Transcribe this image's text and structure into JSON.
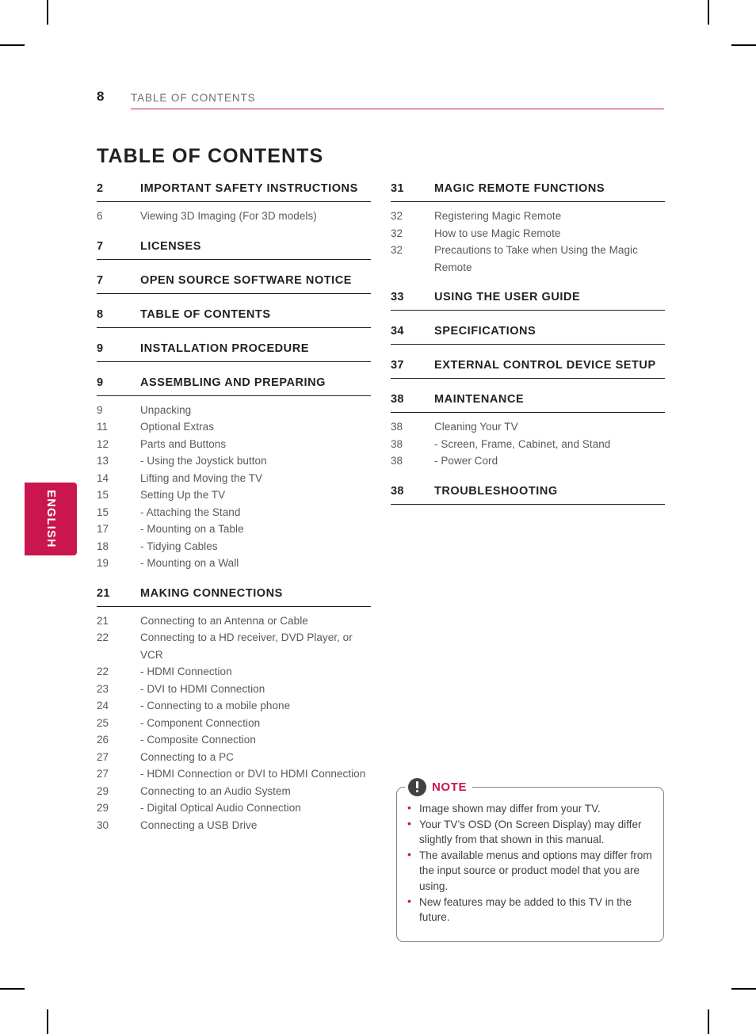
{
  "colors": {
    "accent": "#c9164f",
    "body_text": "#58595b",
    "heading_text": "#231f20",
    "rule": "#231f20",
    "note_border": "#808285",
    "note_icon": "#414042"
  },
  "side_tab": {
    "label": "ENGLISH"
  },
  "running_head": {
    "page_number": "8",
    "title": "TABLE OF CONTENTS"
  },
  "page_heading": "TABLE OF CONTENTS",
  "columns": {
    "left": [
      {
        "number": "2",
        "title": "IMPORTANT SAFETY INSTRUCTIONS",
        "items": [
          {
            "page": "6",
            "text": "Viewing 3D Imaging (For 3D models)",
            "level": 0
          }
        ]
      },
      {
        "number": "7",
        "title": "LICENSES",
        "items": []
      },
      {
        "number": "7",
        "title": "OPEN SOURCE SOFTWARE NOTICE",
        "items": []
      },
      {
        "number": "8",
        "title": "TABLE OF CONTENTS",
        "items": []
      },
      {
        "number": "9",
        "title": "INSTALLATION PROCEDURE",
        "items": []
      },
      {
        "number": "9",
        "title": "ASSEMBLING AND PREPARING",
        "items": [
          {
            "page": "9",
            "text": "Unpacking",
            "level": 0
          },
          {
            "page": "11",
            "text": "Optional Extras",
            "level": 0
          },
          {
            "page": "12",
            "text": "Parts and Buttons",
            "level": 0
          },
          {
            "page": "13",
            "text": "-  Using the Joystick button",
            "level": 1
          },
          {
            "page": "14",
            "text": "Lifting and Moving the TV",
            "level": 0
          },
          {
            "page": "15",
            "text": "Setting Up the TV",
            "level": 0
          },
          {
            "page": "15",
            "text": "-  Attaching the Stand",
            "level": 1
          },
          {
            "page": "17",
            "text": "-  Mounting on a Table",
            "level": 1
          },
          {
            "page": "18",
            "text": "-  Tidying Cables",
            "level": 1
          },
          {
            "page": "19",
            "text": "-  Mounting on a Wall",
            "level": 1
          }
        ]
      },
      {
        "number": "21",
        "title": "MAKING CONNECTIONS",
        "items": [
          {
            "page": "21",
            "text": "Connecting to an Antenna or Cable",
            "level": 0
          },
          {
            "page": "22",
            "text": "Connecting to a HD receiver, DVD Player, or VCR",
            "level": 0
          },
          {
            "page": "22",
            "text": "-  HDMI Connection",
            "level": 1
          },
          {
            "page": "23",
            "text": "-  DVI to HDMI Connection",
            "level": 1
          },
          {
            "page": "24",
            "text": "-  Connecting to a mobile phone",
            "level": 1
          },
          {
            "page": "25",
            "text": "-  Component Connection",
            "level": 1
          },
          {
            "page": "26",
            "text": "-  Composite Connection",
            "level": 1
          },
          {
            "page": "27",
            "text": "Connecting to a PC",
            "level": 0
          },
          {
            "page": "27",
            "text": "-  HDMI Connection or DVI to HDMI Connection",
            "level": 1
          },
          {
            "page": "29",
            "text": "Connecting to an Audio System",
            "level": 0
          },
          {
            "page": "29",
            "text": "-  Digital Optical Audio Connection",
            "level": 1
          },
          {
            "page": "30",
            "text": "Connecting a USB Drive",
            "level": 0
          }
        ]
      }
    ],
    "right": [
      {
        "number": "31",
        "title": "MAGIC REMOTE FUNCTIONS",
        "items": [
          {
            "page": "32",
            "text": "Registering Magic Remote",
            "level": 0
          },
          {
            "page": "32",
            "text": "How to use Magic Remote",
            "level": 0
          },
          {
            "page": "32",
            "text": "Precautions to Take when Using the Magic Remote",
            "level": 0
          }
        ]
      },
      {
        "number": "33",
        "title": "USING THE USER GUIDE",
        "items": []
      },
      {
        "number": "34",
        "title": "SPECIFICATIONS",
        "items": []
      },
      {
        "number": "37",
        "title": "EXTERNAL CONTROL DEVICE SETUP",
        "items": []
      },
      {
        "number": "38",
        "title": "MAINTENANCE",
        "items": [
          {
            "page": "38",
            "text": "Cleaning Your TV",
            "level": 0
          },
          {
            "page": "38",
            "text": "-  Screen, Frame, Cabinet, and Stand",
            "level": 1
          },
          {
            "page": "38",
            "text": "-  Power Cord",
            "level": 1
          }
        ]
      },
      {
        "number": "38",
        "title": "TROUBLESHOOTING",
        "items": []
      }
    ]
  },
  "note": {
    "title": "NOTE",
    "icon": "exclamation-circle-icon",
    "bullets": [
      "Image shown may differ from your TV.",
      "Your TV’s OSD (On Screen Display) may differ slightly from that shown in this manual.",
      "The available menus and options may differ from the input source or product model that you are using.",
      "New features may be added to this TV in the future."
    ]
  }
}
